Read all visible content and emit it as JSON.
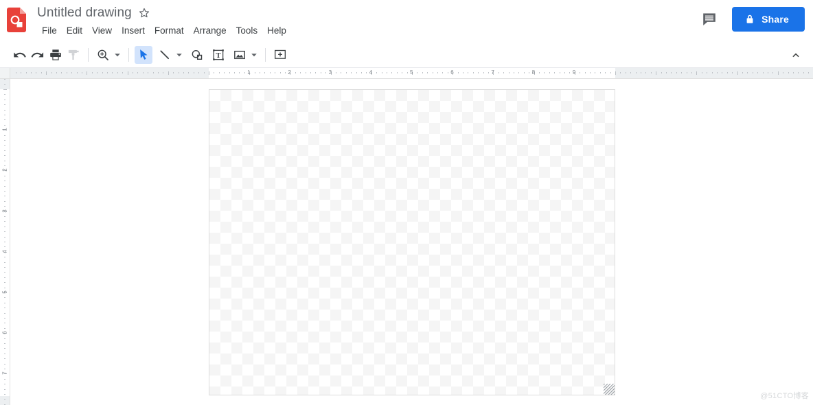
{
  "app": {
    "logo_icon": "google-drawings-logo",
    "title": "Untitled drawing",
    "star_icon": "star-outline-icon"
  },
  "menu": {
    "items": [
      {
        "label": "File"
      },
      {
        "label": "Edit"
      },
      {
        "label": "View"
      },
      {
        "label": "Insert"
      },
      {
        "label": "Format"
      },
      {
        "label": "Arrange"
      },
      {
        "label": "Tools"
      },
      {
        "label": "Help"
      }
    ]
  },
  "header_actions": {
    "comment_icon": "comment-icon",
    "share_label": "Share",
    "share_lock_icon": "lock-icon",
    "share_color": "#1a73e8"
  },
  "toolbar": {
    "collapse_icon": "chevron-up-icon",
    "active_tool": "select",
    "buttons": [
      {
        "name": "undo",
        "icon": "undo-icon",
        "enabled": true
      },
      {
        "name": "redo",
        "icon": "redo-icon",
        "enabled": true
      },
      {
        "name": "print",
        "icon": "print-icon",
        "enabled": true
      },
      {
        "name": "paint-format",
        "icon": "paint-format-icon",
        "enabled": false
      },
      {
        "name": "zoom",
        "icon": "zoom-in-icon",
        "enabled": true
      },
      {
        "name": "select",
        "icon": "cursor-arrow-icon",
        "enabled": true
      },
      {
        "name": "line",
        "icon": "line-icon",
        "enabled": true
      },
      {
        "name": "shape",
        "icon": "shape-icon",
        "enabled": true
      },
      {
        "name": "text-box",
        "icon": "text-box-icon",
        "enabled": true
      },
      {
        "name": "image",
        "icon": "image-icon",
        "enabled": true
      },
      {
        "name": "comment-insert",
        "icon": "add-comment-icon",
        "enabled": true
      }
    ]
  },
  "rulers": {
    "horizontal_units": [
      "1",
      "2",
      "3",
      "4",
      "5",
      "6",
      "7",
      "8",
      "9"
    ],
    "vertical_units": [
      "1",
      "2",
      "3",
      "4",
      "5",
      "6",
      "7"
    ]
  },
  "canvas": {
    "background": "transparent-checkerboard",
    "resize_handle_icon": "resize-grip-icon"
  },
  "watermark": {
    "text": "@51CTO博客"
  }
}
